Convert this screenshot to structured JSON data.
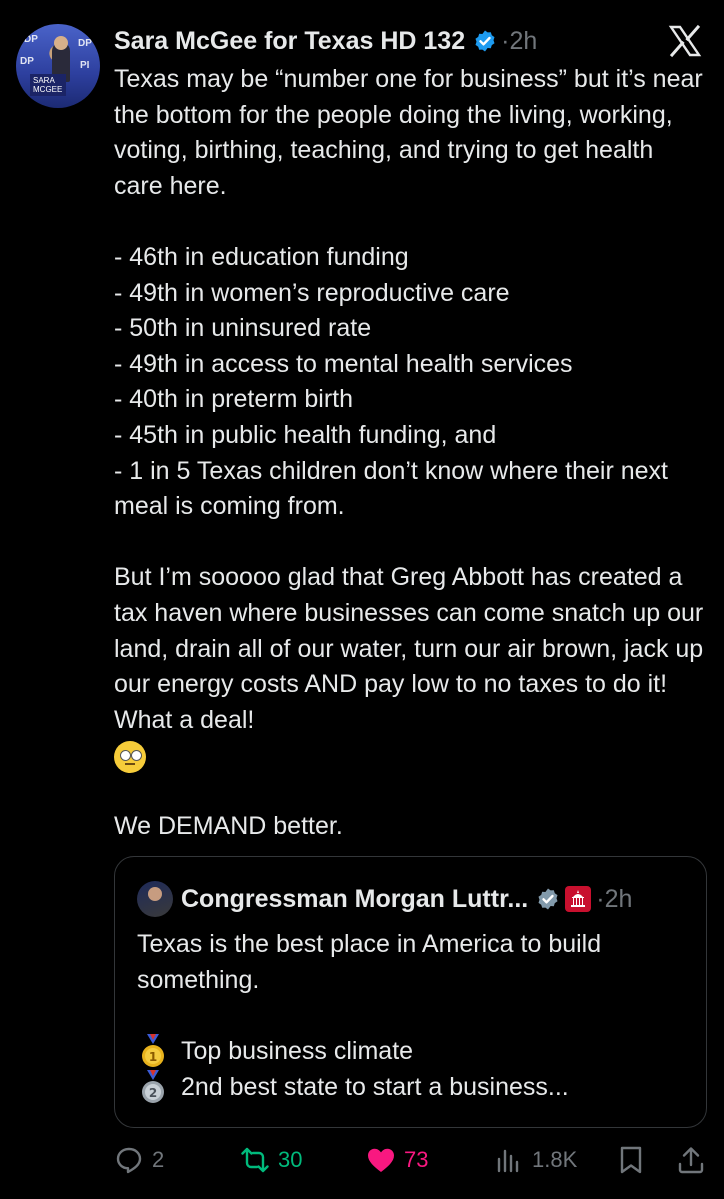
{
  "author": {
    "name": "Sara McGee for Texas HD 132",
    "time": "2h",
    "avatar_banner": "SARA MCGEE"
  },
  "tweet_paragraphs": [
    [
      "Texas may be “number one for business” but it’s near the bottom for the people doing the living, working, voting, birthing, teaching, and trying to get health care here."
    ],
    [
      "- 46th in education funding",
      "- 49th in women’s reproductive care",
      "- 50th in uninsured rate",
      "- 49th in access to mental health services",
      "- 40th in preterm birth",
      "- 45th in public health funding, and",
      "- 1 in 5 Texas children don’t know where their next meal is coming from."
    ],
    [
      "But I’m sooooo glad that Greg Abbott has created a tax haven where businesses can come snatch up our land, drain all of our water, turn our air brown, jack up our energy costs AND pay low to no taxes to do it! What a deal!"
    ],
    [
      "We DEMAND better."
    ]
  ],
  "emoji": "face-with-rolling-eyes",
  "quoted": {
    "name": "Congressman Morgan Luttr...",
    "time": "2h",
    "text": "Texas is the best place in America to build something.",
    "items": [
      {
        "medal": "1",
        "text": "Top business climate"
      },
      {
        "medal": "2",
        "text": "2nd best state to start a business..."
      }
    ]
  },
  "actions": {
    "replies": "2",
    "reposts": "30",
    "likes": "73",
    "views": "1.8K"
  },
  "colors": {
    "background": "#000000",
    "text": "#e7e9ea",
    "muted": "#71767b",
    "verified": "#1d9bf0",
    "repost": "#00ba7c",
    "like": "#f91880"
  },
  "icons": [
    "x-logo-icon",
    "verified-badge-icon",
    "reply-icon",
    "repost-icon",
    "like-icon",
    "views-icon",
    "bookmark-icon",
    "share-icon"
  ]
}
